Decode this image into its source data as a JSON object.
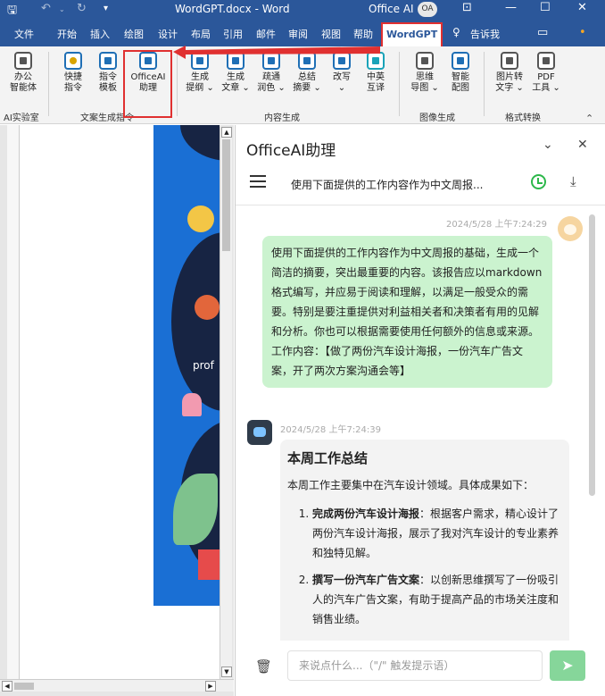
{
  "window": {
    "title": "WordGPT.docx  -  Word",
    "account_label": "Office AI",
    "account_initials": "OA",
    "colors": {
      "titlebar": "#2b579a",
      "highlight": "#e03030",
      "user_bubble": "#cbf3cf"
    }
  },
  "tabs": [
    {
      "label": "文件"
    },
    {
      "label": "开始"
    },
    {
      "label": "插入"
    },
    {
      "label": "绘图"
    },
    {
      "label": "设计"
    },
    {
      "label": "布局"
    },
    {
      "label": "引用"
    },
    {
      "label": "邮件"
    },
    {
      "label": "审阅"
    },
    {
      "label": "视图"
    },
    {
      "label": "帮助"
    },
    {
      "label": "WordGPT"
    }
  ],
  "tellme": "告诉我",
  "ribbon": {
    "buttons": [
      {
        "label": "办公\n智能体"
      },
      {
        "label": "快捷\n指令"
      },
      {
        "label": "指令\n模板"
      },
      {
        "label": "OfficeAI\n助理"
      },
      {
        "label": "生成\n提纲 ⌄"
      },
      {
        "label": "生成\n文章 ⌄"
      },
      {
        "label": "疏通\n润色 ⌄"
      },
      {
        "label": "总结\n摘要 ⌄"
      },
      {
        "label": "改写\n⌄"
      },
      {
        "label": "中英\n互译"
      },
      {
        "label": "思维\n导图 ⌄"
      },
      {
        "label": "智能\n配图"
      },
      {
        "label": "图片转\n文字 ⌄"
      },
      {
        "label": "PDF\n工具 ⌄"
      }
    ],
    "groups": [
      {
        "label": "AI实验室"
      },
      {
        "label": "文案生成指令"
      },
      {
        "label": "内容生成"
      },
      {
        "label": "图像生成"
      },
      {
        "label": "格式转换"
      }
    ]
  },
  "document": {
    "image_text": "prof"
  },
  "assistant": {
    "title": "OfficeAI助理",
    "conversation_title": "使用下面提供的工作内容作为中文周报...",
    "user_timestamp": "2024/5/28 上午7:24:29",
    "user_message": "使用下面提供的工作内容作为中文周报的基础，生成一个简洁的摘要，突出最重要的内容。该报告应以markdown 格式编写，并应易于阅读和理解，以满足一般受众的需要。特别是要注重提供对利益相关者和决策者有用的见解和分析。你也可以根据需要使用任何额外的信息或来源。",
    "user_work": "工作内容：【做了两份汽车设计海报，一份汽车广告文案，开了两次方案沟通会等】",
    "bot_timestamp": "2024/5/28 上午7:24:39",
    "bot_heading": "本周工作总结",
    "bot_intro": "本周工作主要集中在汽车设计领域。具体成果如下：",
    "bot_items": [
      {
        "title": "完成两份汽车设计海报",
        "text": "：根据客户需求，精心设计了两份汽车设计海报，展示了我对汽车设计的专业素养和独特见解。"
      },
      {
        "title": "撰写一份汽车广告文案",
        "text": "：以创新思维撰写了一份吸引人的汽车广告文案，有助于提高产品的市场关注度和销售业绩。"
      }
    ],
    "input_placeholder": "来说点什么...（\"/\" 触发提示语）"
  }
}
